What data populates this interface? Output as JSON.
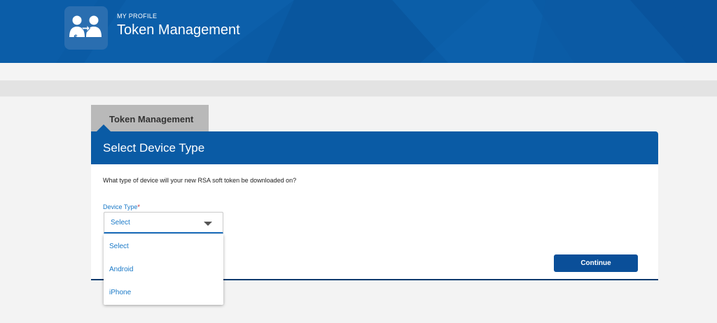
{
  "header": {
    "eyebrow": "MY PROFILE",
    "title": "Token Management",
    "logo_icon": "users-exchange-icon"
  },
  "tab": {
    "label": "Token Management"
  },
  "panel": {
    "title": "Select Device Type",
    "question": "What type of device will your new RSA soft token be downloaded on?"
  },
  "field": {
    "label": "Device Type",
    "required_marker": "*",
    "selected": "Select",
    "caret_icon": "caret-down-icon",
    "options": [
      "Select",
      "Android",
      "iPhone"
    ]
  },
  "actions": {
    "continue_label": "Continue"
  },
  "colors": {
    "brand_blue": "#0a5ba5",
    "link_blue": "#1a79c7",
    "button_blue": "#0a4f99",
    "tab_gray": "#b9b9b9"
  }
}
